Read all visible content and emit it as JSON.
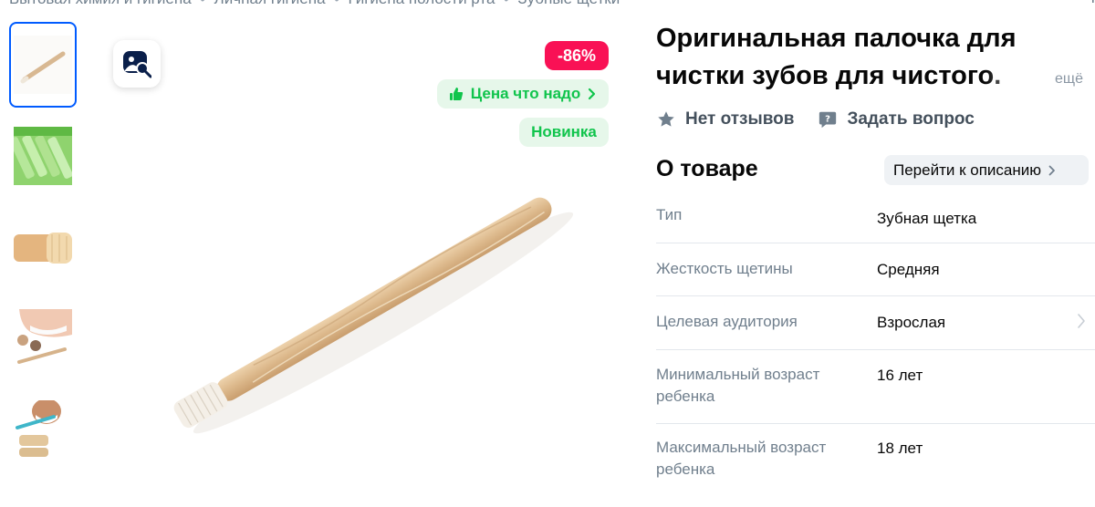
{
  "breadcrumb": {
    "items": [
      "Бытовая химия и гигиена",
      "Личная гигиена",
      "Гигиена полости рта",
      "Зубные щетки"
    ],
    "separator": "•",
    "right_text": "Ч"
  },
  "gallery": {
    "thumbnail_count": 5,
    "badges": {
      "discount": "-86%",
      "price_label": "Цена что надо",
      "new_label": "Новинка"
    },
    "colors": {
      "discount": "#f91155",
      "green_text": "#10c44c",
      "green_bg": "#e6f7ea",
      "active_border": "#005bff"
    }
  },
  "product": {
    "title": "Оригинальная палочка для чистки зубов для чистого.",
    "more_label": "ещё",
    "reviews_label": "Нет отзывов",
    "question_label": "Задать вопрос"
  },
  "about": {
    "title": "О товаре",
    "goto_label": "Перейти к описанию",
    "specs": [
      {
        "label": "Тип",
        "value": "Зубная щетка"
      },
      {
        "label": "Жесткость щетины",
        "value": "Средняя"
      },
      {
        "label": "Целевая аудитория",
        "value": "Взрослая"
      },
      {
        "label": "Минимальный возраст ребенка",
        "value": "16 лет"
      },
      {
        "label": "Максимальный возраст ребенка",
        "value": "18 лет"
      }
    ]
  },
  "icons": {
    "search_photo": "image-search-icon",
    "thumbs_up": "thumbs-up-icon",
    "star": "star-icon",
    "question": "question-bubble-icon",
    "chevron": "chevron-right-icon"
  }
}
